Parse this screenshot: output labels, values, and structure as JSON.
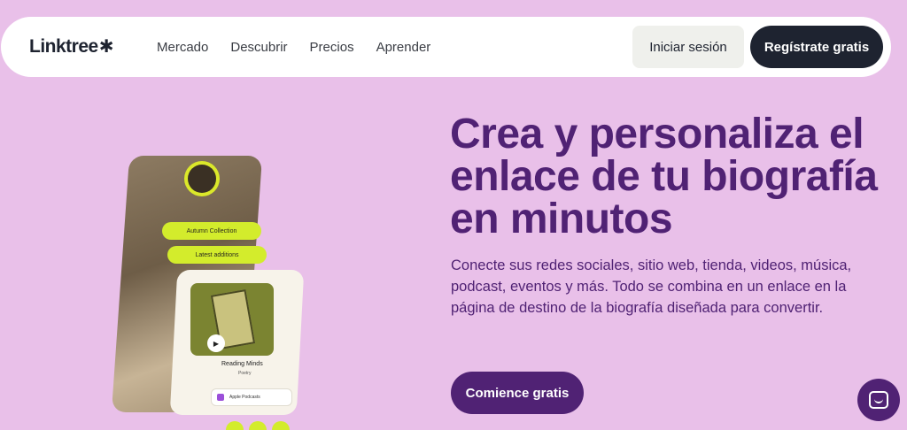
{
  "nav": {
    "logo_text": "Linktree",
    "logo_mark": "✱",
    "links": [
      "Mercado",
      "Descubrir",
      "Precios",
      "Aprender"
    ],
    "login_label": "Iniciar sesión",
    "signup_label": "Regístrate gratis"
  },
  "hero": {
    "title": "Crea y personaliza el enlace de tu biografía en minutos",
    "description": "Conecte sus redes sociales, sitio web, tienda, videos, música, podcast, eventos y más. Todo se combina en un enlace en la página de destino de la biografía diseñada para convertir.",
    "cta_label": "Comience gratis"
  },
  "phone": {
    "pill1": "Autumn Collection",
    "pill2": "Latest additions",
    "card_title": "Reading Minds",
    "card_sub": "Poetry",
    "card_btn": "Apple Podcasts"
  },
  "icons": {
    "chat": "chat-icon",
    "play": "play-icon"
  },
  "colors": {
    "background": "#e9c0e9",
    "primary": "#502274",
    "dark": "#1e2330",
    "accent": "#d3ec2c"
  }
}
